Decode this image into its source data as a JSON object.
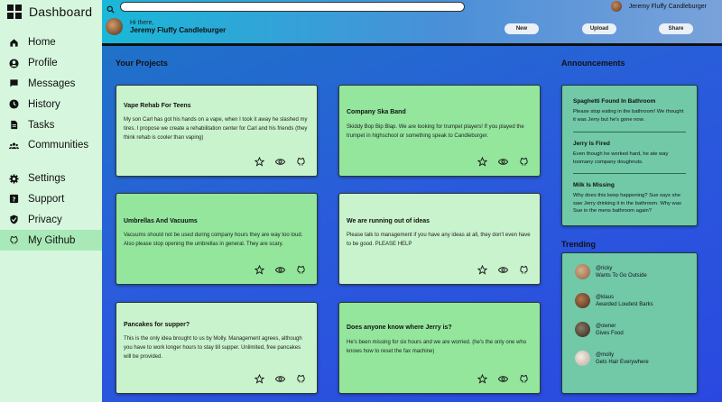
{
  "brand": {
    "title": "Dashboard"
  },
  "nav": {
    "primary": [
      {
        "label": "Home",
        "icon": "home-icon"
      },
      {
        "label": "Profile",
        "icon": "profile-icon"
      },
      {
        "label": "Messages",
        "icon": "messages-icon"
      },
      {
        "label": "History",
        "icon": "history-icon"
      },
      {
        "label": "Tasks",
        "icon": "tasks-icon"
      },
      {
        "label": "Communities",
        "icon": "communities-icon"
      }
    ],
    "secondary": [
      {
        "label": "Settings",
        "icon": "gear-icon"
      },
      {
        "label": "Support",
        "icon": "support-icon"
      },
      {
        "label": "Privacy",
        "icon": "shield-icon"
      },
      {
        "label": "My Github",
        "icon": "github-icon"
      }
    ]
  },
  "header": {
    "search_value": "",
    "username": "Jeremy Fluffy Candleburger",
    "greeting": "Hi there,",
    "full_name": "Jeremy Fluffy Candleburger",
    "buttons": {
      "new": "New",
      "upload": "Upload",
      "share": "Share"
    }
  },
  "projects": {
    "title": "Your Projects",
    "items": [
      {
        "title": "Vape Rehab For Teens",
        "desc": "My son Carl has got his hands on a vape, when I took it away he slashed my tires. I propose we create a rehabilitation center for Carl and his friends (they think rehab is cooler than vaping)"
      },
      {
        "title": "Company Ska Band",
        "desc": "Skiddy Bop Bip Blap. We are looking for trumpet players! If you played the trumpet in highschool or something speak to Candleburger."
      },
      {
        "title": "Umbrellas And Vacuums",
        "desc": "Vacuums should not be used during company hours they are way too loud. Also please stop opening the umbrellas in general. They are scary."
      },
      {
        "title": "We are running out of ideas",
        "desc": "Please talk to management if you have any ideas at all, they don't even have to be good. PLEASE HELP"
      },
      {
        "title": "Pancakes for supper?",
        "desc": "This is the only idea brought to us by Molly. Management agrees, although you have to work longer hours to stay till supper. Unlimited, free pancakes will be provided."
      },
      {
        "title": "Does anyone know where Jerry is?",
        "desc": "He's been missing for six hours and we are worried. (he's the only one who knows how to reset the fax machine)"
      }
    ]
  },
  "announcements": {
    "title": "Announcements",
    "items": [
      {
        "title": "Spaghetti Found In Bathroom",
        "body": "Please stop eating in the bathroom! We thought it was Jerry but he's gone now."
      },
      {
        "title": "Jerry Is Fired",
        "body": "Even though he worked hard, he ate way toomany company doughnuts."
      },
      {
        "title": "Milk Is Missing",
        "body": "Why does this keep happening? Sue says she saw Jerry drinking it in the bathroom. Why was Sue in the mens bathroom again?"
      }
    ]
  },
  "trending": {
    "title": "Trending",
    "items": [
      {
        "user": "@ricky",
        "desc": "Wants To Go Outside",
        "color": "#c9a27a"
      },
      {
        "user": "@klaus",
        "desc": "Awarded Loudest Barks",
        "color": "#8a5a3a"
      },
      {
        "user": "@owner",
        "desc": "Gives Food",
        "color": "#5a4a3a"
      },
      {
        "user": "@molly",
        "desc": "Gets Hair Everywhere",
        "color": "#e8ddd2"
      }
    ]
  },
  "colors": {
    "sidebar_bg": "#d6f7de",
    "sidebar_active": "#a9e9b8",
    "card_light": "#c9f3cd",
    "card_mid": "#94e69d",
    "panel": "#72c9a7"
  }
}
